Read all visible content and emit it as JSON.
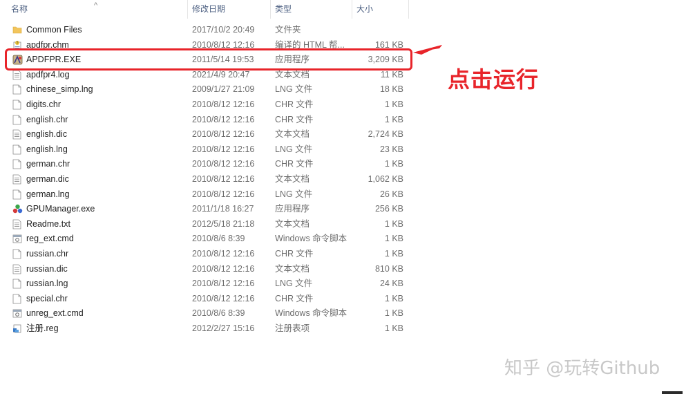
{
  "header": {
    "name": "名称",
    "date": "修改日期",
    "type": "类型",
    "size": "大小",
    "sort_arrow": "^"
  },
  "files": [
    {
      "name": "Common Files",
      "date": "2017/10/2 20:49",
      "type": "文件夹",
      "size": "",
      "icon": "folder-icon"
    },
    {
      "name": "apdfpr.chm",
      "date": "2010/8/12 12:16",
      "type": "编译的 HTML 帮...",
      "size": "161 KB",
      "icon": "help-file-icon"
    },
    {
      "name": "APDFPR.EXE",
      "date": "2011/5/14 19:53",
      "type": "应用程序",
      "size": "3,209 KB",
      "icon": "app-icon"
    },
    {
      "name": "apdfpr4.log",
      "date": "2021/4/9 20:47",
      "type": "文本文档",
      "size": "11 KB",
      "icon": "text-file-icon"
    },
    {
      "name": "chinese_simp.lng",
      "date": "2009/1/27 21:09",
      "type": "LNG 文件",
      "size": "18 KB",
      "icon": "blank-file-icon"
    },
    {
      "name": "digits.chr",
      "date": "2010/8/12 12:16",
      "type": "CHR 文件",
      "size": "1 KB",
      "icon": "blank-file-icon"
    },
    {
      "name": "english.chr",
      "date": "2010/8/12 12:16",
      "type": "CHR 文件",
      "size": "1 KB",
      "icon": "blank-file-icon"
    },
    {
      "name": "english.dic",
      "date": "2010/8/12 12:16",
      "type": "文本文档",
      "size": "2,724 KB",
      "icon": "text-file-icon"
    },
    {
      "name": "english.lng",
      "date": "2010/8/12 12:16",
      "type": "LNG 文件",
      "size": "23 KB",
      "icon": "blank-file-icon"
    },
    {
      "name": "german.chr",
      "date": "2010/8/12 12:16",
      "type": "CHR 文件",
      "size": "1 KB",
      "icon": "blank-file-icon"
    },
    {
      "name": "german.dic",
      "date": "2010/8/12 12:16",
      "type": "文本文档",
      "size": "1,062 KB",
      "icon": "text-file-icon"
    },
    {
      "name": "german.lng",
      "date": "2010/8/12 12:16",
      "type": "LNG 文件",
      "size": "26 KB",
      "icon": "blank-file-icon"
    },
    {
      "name": "GPUManager.exe",
      "date": "2011/1/18 16:27",
      "type": "应用程序",
      "size": "256 KB",
      "icon": "gpu-app-icon"
    },
    {
      "name": "Readme.txt",
      "date": "2012/5/18 21:18",
      "type": "文本文档",
      "size": "1 KB",
      "icon": "text-file-icon"
    },
    {
      "name": "reg_ext.cmd",
      "date": "2010/8/6 8:39",
      "type": "Windows 命令脚本",
      "size": "1 KB",
      "icon": "cmd-file-icon"
    },
    {
      "name": "russian.chr",
      "date": "2010/8/12 12:16",
      "type": "CHR 文件",
      "size": "1 KB",
      "icon": "blank-file-icon"
    },
    {
      "name": "russian.dic",
      "date": "2010/8/12 12:16",
      "type": "文本文档",
      "size": "810 KB",
      "icon": "text-file-icon"
    },
    {
      "name": "russian.lng",
      "date": "2010/8/12 12:16",
      "type": "LNG 文件",
      "size": "24 KB",
      "icon": "blank-file-icon"
    },
    {
      "name": "special.chr",
      "date": "2010/8/12 12:16",
      "type": "CHR 文件",
      "size": "1 KB",
      "icon": "blank-file-icon"
    },
    {
      "name": "unreg_ext.cmd",
      "date": "2010/8/6 8:39",
      "type": "Windows 命令脚本",
      "size": "1 KB",
      "icon": "cmd-file-icon"
    },
    {
      "name": "注册.reg",
      "date": "2012/2/27 15:16",
      "type": "注册表项",
      "size": "1 KB",
      "icon": "registry-file-icon"
    }
  ],
  "annotation": {
    "text": "点击运行",
    "color": "#e8242a"
  },
  "watermark": {
    "text": "知乎 @玩转Github"
  },
  "colors": {
    "header_text": "#4d6082",
    "folder": "#f2c55c",
    "highlight": "#e8242a"
  }
}
